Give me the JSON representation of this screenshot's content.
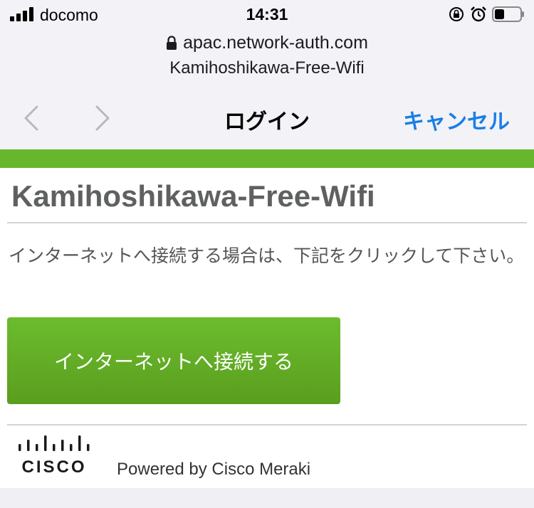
{
  "status_bar": {
    "carrier": "docomo",
    "time": "14:31",
    "icons": [
      "signal-icon",
      "orientation-lock-icon",
      "alarm-icon",
      "battery-icon"
    ]
  },
  "url_bar": {
    "domain": "apac.network-auth.com",
    "ssid": "Kamihoshikawa-Free-Wifi"
  },
  "nav": {
    "title": "ログイン",
    "cancel_label": "キャンセル"
  },
  "page": {
    "heading": "Kamihoshikawa-Free-Wifi",
    "instruction": "インターネットへ接続する場合は、下記をクリックして下さい。",
    "connect_label": "インターネットへ接続する",
    "cisco_wordmark": "CISCO",
    "powered_by": "Powered by Cisco Meraki"
  },
  "colors": {
    "accent_green": "#67b72c",
    "ios_blue": "#1a7ee6"
  }
}
